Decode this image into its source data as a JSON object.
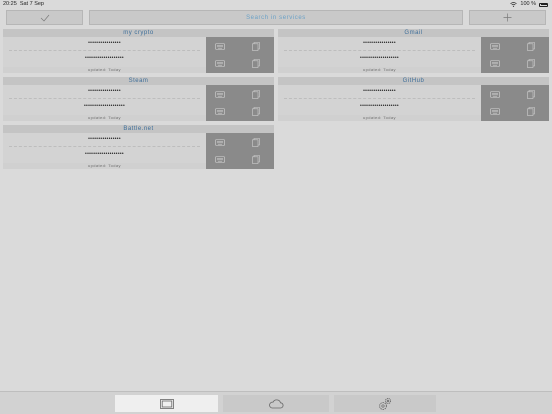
{
  "status_bar": {
    "time": "20:25",
    "date": "Sat 7 Sep",
    "battery": "100 %"
  },
  "toolbar": {
    "confirm_icon": "checkmark-icon",
    "search_label": "Search in services",
    "add_icon": "plus-icon"
  },
  "cards": [
    {
      "title": "my crypto",
      "password1": "••••••••••••••••",
      "password2": "•••••••••••••••••••",
      "updated": "updated: Today"
    },
    {
      "title": "Gmail",
      "password1": "••••••••••••••••",
      "password2": "•••••••••••••••••••",
      "updated": "updated: Today"
    },
    {
      "title": "Steam",
      "password1": "••••••••••••••••",
      "password2": "••••••••••••••••••••",
      "updated": "updated: Today"
    },
    {
      "title": "GitHub",
      "password1": "••••••••••••••••",
      "password2": "•••••••••••••••••••",
      "updated": "updated: Today"
    },
    {
      "title": "Battle.net",
      "password1": "••••••••••••••••",
      "password2": "•••••••••••••••••••",
      "updated": "updated: Today"
    }
  ],
  "tabbar": {
    "tabs": [
      "vault-tab",
      "cloud-tab",
      "settings-tab"
    ],
    "active": "vault-tab"
  },
  "colors": {
    "accent": "#3f6f9a",
    "action_panel": "#8a8a8a",
    "background": "#dadada"
  }
}
